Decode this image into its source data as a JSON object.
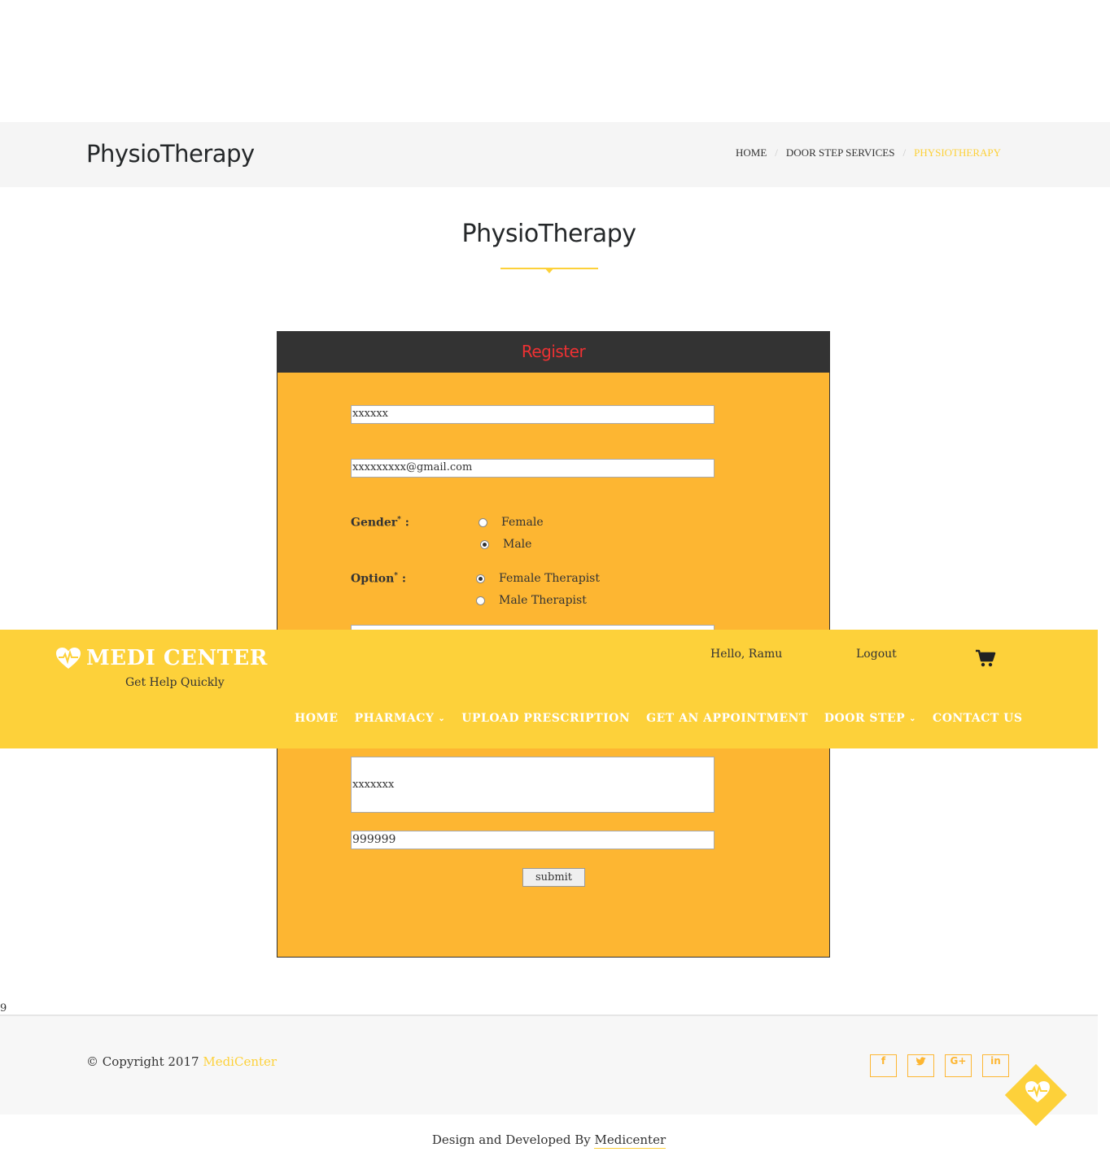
{
  "page_header": {
    "title": "PhysioTherapy",
    "breadcrumb": [
      "HOME",
      "DOOR STEP SERVICES",
      "PHYSIOTHERAPY"
    ]
  },
  "section": {
    "title": "PhysioTherapy"
  },
  "form": {
    "header": "Register",
    "name_value": "xxxxxx",
    "email_value": "xxxxxxxxx@gmail.com",
    "gender_label": "Gender",
    "gender_options": [
      {
        "label": "Female",
        "checked": false
      },
      {
        "label": "Male",
        "checked": true
      }
    ],
    "option_label": "Option",
    "therapist_options": [
      {
        "label": "Female Therapist",
        "checked": true
      },
      {
        "label": "Male Therapist",
        "checked": false
      }
    ],
    "address_value": "xxxxxxx",
    "pincode_value": "999999",
    "submit_label": "submit",
    "required_mark": "*",
    "label_suffix": " :"
  },
  "header": {
    "brand": "MEDI CENTER",
    "tagline": "Get Help Quickly",
    "greeting": "Hello, Ramu",
    "logout": "Logout",
    "cart_icon": "shopping-cart-icon",
    "nav": [
      {
        "label": "HOME",
        "dropdown": false
      },
      {
        "label": "PHARMACY",
        "dropdown": true
      },
      {
        "label": "UPLOAD PRESCRIPTION",
        "dropdown": false
      },
      {
        "label": "GET AN APPOINTMENT",
        "dropdown": false
      },
      {
        "label": "DOOR STEP",
        "dropdown": true
      },
      {
        "label": "CONTACT US",
        "dropdown": false
      }
    ]
  },
  "stray_text": "9",
  "footer": {
    "copyright_prefix": "© Copyright 2017",
    "brand": "MediCenter",
    "social": [
      {
        "icon": "facebook-icon",
        "glyph": "f"
      },
      {
        "icon": "twitter-icon",
        "glyph": "t"
      },
      {
        "icon": "google-plus-icon",
        "glyph": "G+"
      },
      {
        "icon": "linkedin-icon",
        "glyph": "in"
      }
    ],
    "credits_prefix": "Design and Developed By",
    "credits_link": "Medicenter"
  },
  "colors": {
    "accent": "#fdd13a",
    "panel": "#fdb632",
    "panel_header": "#333333",
    "register_text": "#ee3133"
  }
}
